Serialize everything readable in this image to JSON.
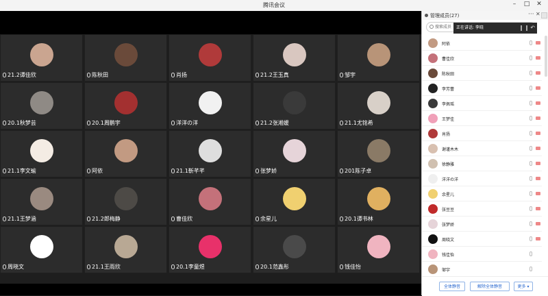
{
  "window": {
    "title": "腾讯会议"
  },
  "grid": {
    "tiles": [
      {
        "name": "21.2谭佳欣",
        "color": "#caa590"
      },
      {
        "name": "陈秋田",
        "color": "#6a4a3a"
      },
      {
        "name": "肖扬",
        "color": "#b03a3a"
      },
      {
        "name": "21.2王玉真",
        "color": "#d9c7c0"
      },
      {
        "name": "邹宇",
        "color": "#b89478"
      },
      {
        "name": "20.1秋梦芸",
        "color": "#8f8a85"
      },
      {
        "name": "20.1周鹏宇",
        "color": "#a33030"
      },
      {
        "name": "洋洋の洋",
        "color": "#f1f1f1"
      },
      {
        "name": "21.2张湘媛",
        "color": "#3a3a3a"
      },
      {
        "name": "21.1尤铭希",
        "color": "#d8d0c8"
      },
      {
        "name": "21.1李文瑜",
        "color": "#f4ece4"
      },
      {
        "name": "阿依",
        "color": "#c29a82"
      },
      {
        "name": "21.1靳芊芊",
        "color": "#dedede"
      },
      {
        "name": "张梦娇",
        "color": "#e6d4d9"
      },
      {
        "name": "201陈子卓",
        "color": "#8a7a66"
      },
      {
        "name": "21.1王梦涵",
        "color": "#9a8a80"
      },
      {
        "name": "21.2郎梅静",
        "color": "#4d4a46"
      },
      {
        "name": "曹佳欣",
        "color": "#c4717a"
      },
      {
        "name": "余星儿",
        "color": "#f0d070"
      },
      {
        "name": "20.1谭书林",
        "color": "#e0b060"
      },
      {
        "name": "周晓文",
        "color": "#ffffff"
      },
      {
        "name": "21.1王雨欣",
        "color": "#b8a894"
      },
      {
        "name": "20.1李童煜",
        "color": "#e8316a"
      },
      {
        "name": "20.1范鑫彤",
        "color": "#4a4a4a"
      },
      {
        "name": "钱佳怡",
        "color": "#f0b4c0"
      }
    ]
  },
  "panel": {
    "title": "管理成员(27)",
    "search_placeholder": "搜索成员",
    "speaking_text": "正在讲话: 李晓",
    "members": [
      {
        "name": "阿依",
        "color": "#c29a82"
      },
      {
        "name": "曹佳欣",
        "color": "#c4717a"
      },
      {
        "name": "陈秋田",
        "color": "#6a4a3a"
      },
      {
        "name": "李芳蕾",
        "color": "#222222"
      },
      {
        "name": "李佩瑶",
        "color": "#3a3a3a"
      },
      {
        "name": "王梦佳",
        "color": "#f0a0b8"
      },
      {
        "name": "肖扬",
        "color": "#b03a3a"
      },
      {
        "name": "谢谨木木",
        "color": "#d8c0b0"
      },
      {
        "name": "徐静雅",
        "color": "#d0c0b0"
      },
      {
        "name": "洋洋の洋",
        "color": "#efefef"
      },
      {
        "name": "余星儿",
        "color": "#f0d070"
      },
      {
        "name": "张豆豆",
        "color": "#c02a2a"
      },
      {
        "name": "张梦娇",
        "color": "#e6d4d9"
      },
      {
        "name": "周晓文",
        "color": "#111111"
      },
      {
        "name": "钱佳怡",
        "color": "#f0b4c0"
      },
      {
        "name": "邹宇",
        "color": "#b89478"
      }
    ],
    "buttons": {
      "mute_all": "全体静音",
      "unmute_all": "解除全体静音",
      "more": "更多 ▾"
    }
  }
}
